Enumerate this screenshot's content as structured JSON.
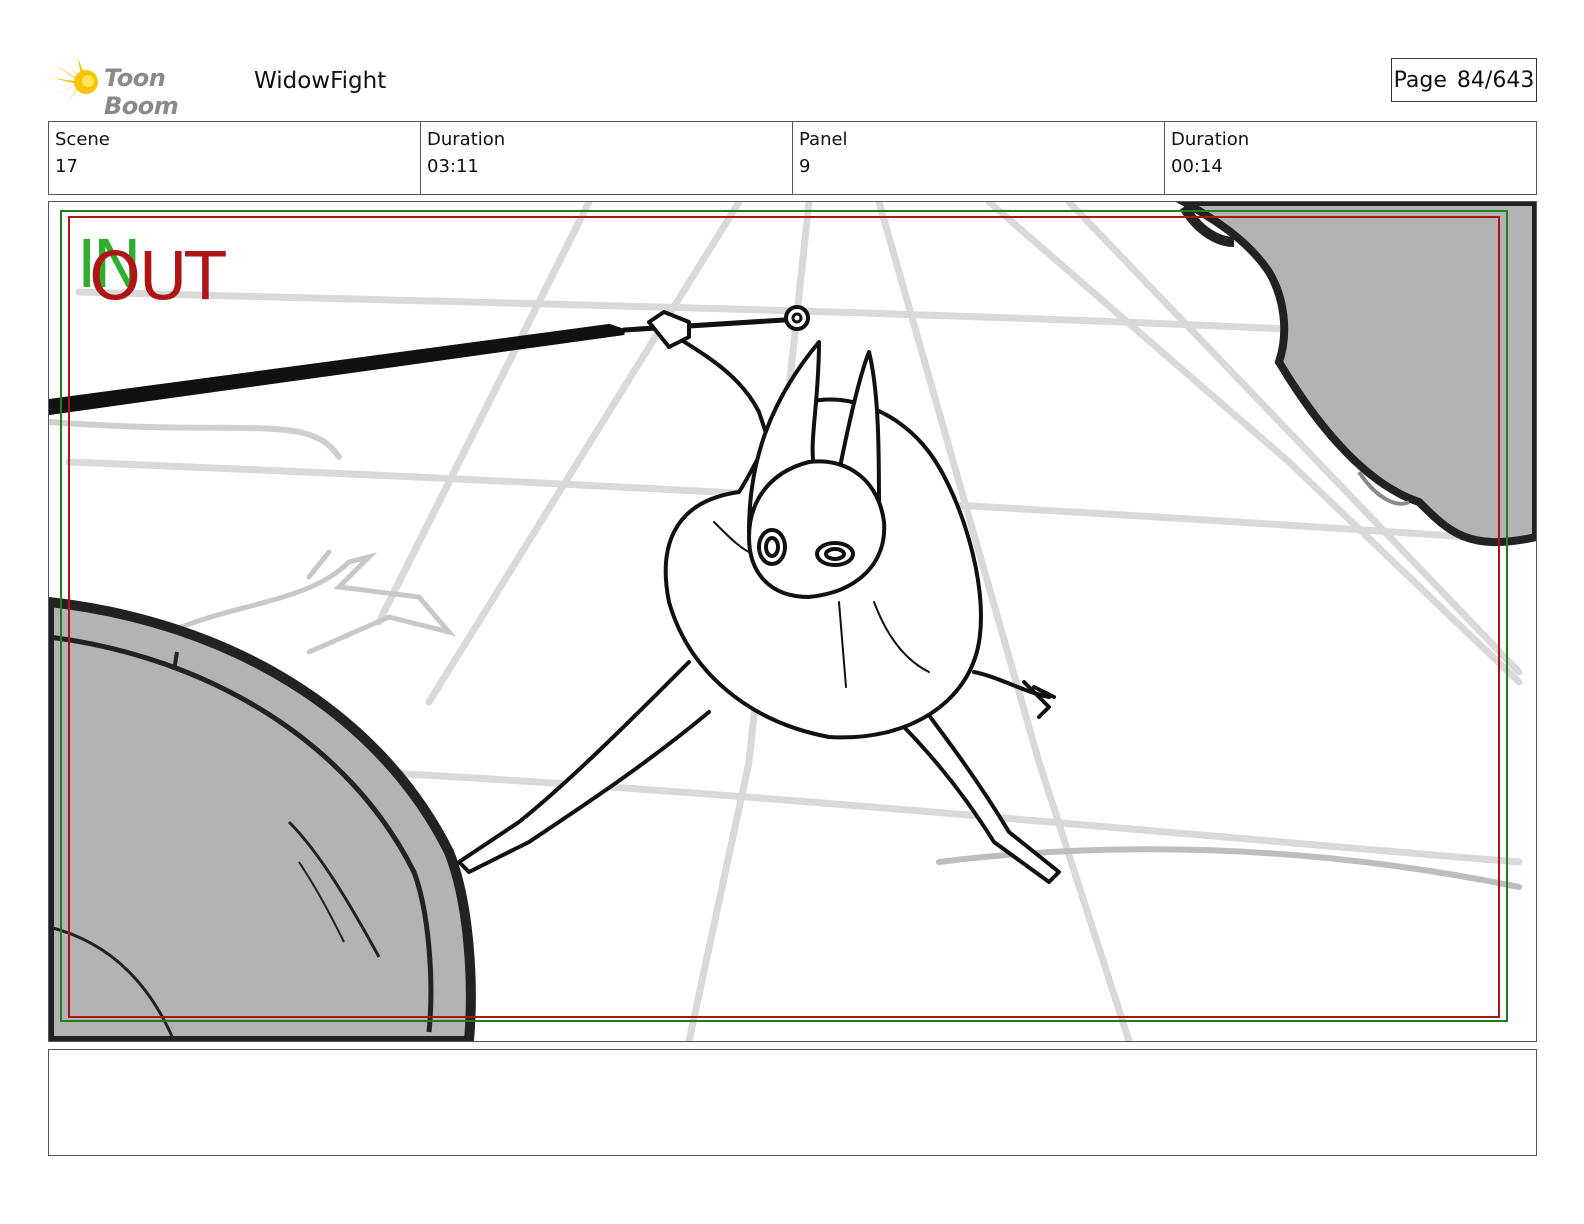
{
  "header": {
    "brand_name": "Toon Boom",
    "project_title": "WidowFight",
    "page_label": "Page",
    "page_number": "84/643"
  },
  "info": {
    "scene_label": "Scene",
    "scene_value": "17",
    "scene_duration_label": "Duration",
    "scene_duration_value": "03:11",
    "panel_label": "Panel",
    "panel_value": "9",
    "panel_duration_label": "Duration",
    "panel_duration_value": "00:14"
  },
  "panel_markers": {
    "in_label": "IN",
    "out_label": "OUT",
    "in_color": "#2fae2f",
    "out_color": "#b01515"
  },
  "caption": ""
}
